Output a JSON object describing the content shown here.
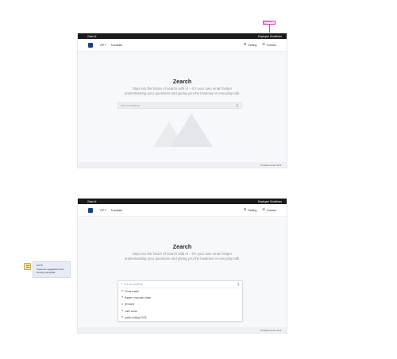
{
  "annotation": {
    "label": "Employee link"
  },
  "frame1": {
    "topbar": {
      "brand": "Zeiss AI",
      "link": "Employee Guidelines"
    },
    "nav": {
      "links": [
        "GPT",
        "Translate"
      ],
      "settings": "Setting",
      "contact": "Contact"
    },
    "main": {
      "title": "Zearch",
      "subtitle": "Step into the future of search with AI – it's your own smart helper understanding your questions and giving you the lowdown in everyday talk.",
      "search_placeholder": "Ask me anything"
    },
    "footer": {
      "version": "Product name V0.3"
    }
  },
  "frame2": {
    "topbar": {
      "brand": "Zeiss AI",
      "link": "Employee Guidelines"
    },
    "nav": {
      "links": [
        "GPT",
        "Translate"
      ],
      "settings": "Setting",
      "contact": "Contact"
    },
    "main": {
      "title": "Zearch",
      "subtitle": "Step into the future of search with AI – it's your own smart helper understanding your questions and giving you the lowdown in everyday talk.",
      "search_placeholder": "Ask me anything",
      "suggestions": [
        "Fema match",
        "Bayern munchen rotten",
        "jet stone",
        "coke cards",
        "public holiday 2025"
      ]
    },
    "footer": {
      "version": "Product name V0.3"
    }
  },
  "note": {
    "title": "NOTE",
    "text": "These are suggestions from the day, favourable"
  },
  "icons": {
    "settings": "gear-icon",
    "contact": "mail-icon",
    "search": "search-icon",
    "mic": "mic-icon"
  },
  "colors": {
    "topbar": "#1a1a1a",
    "logo": "#1b3e8c",
    "annotation": "#e040c0",
    "note_bg": "#e6ebf5"
  }
}
